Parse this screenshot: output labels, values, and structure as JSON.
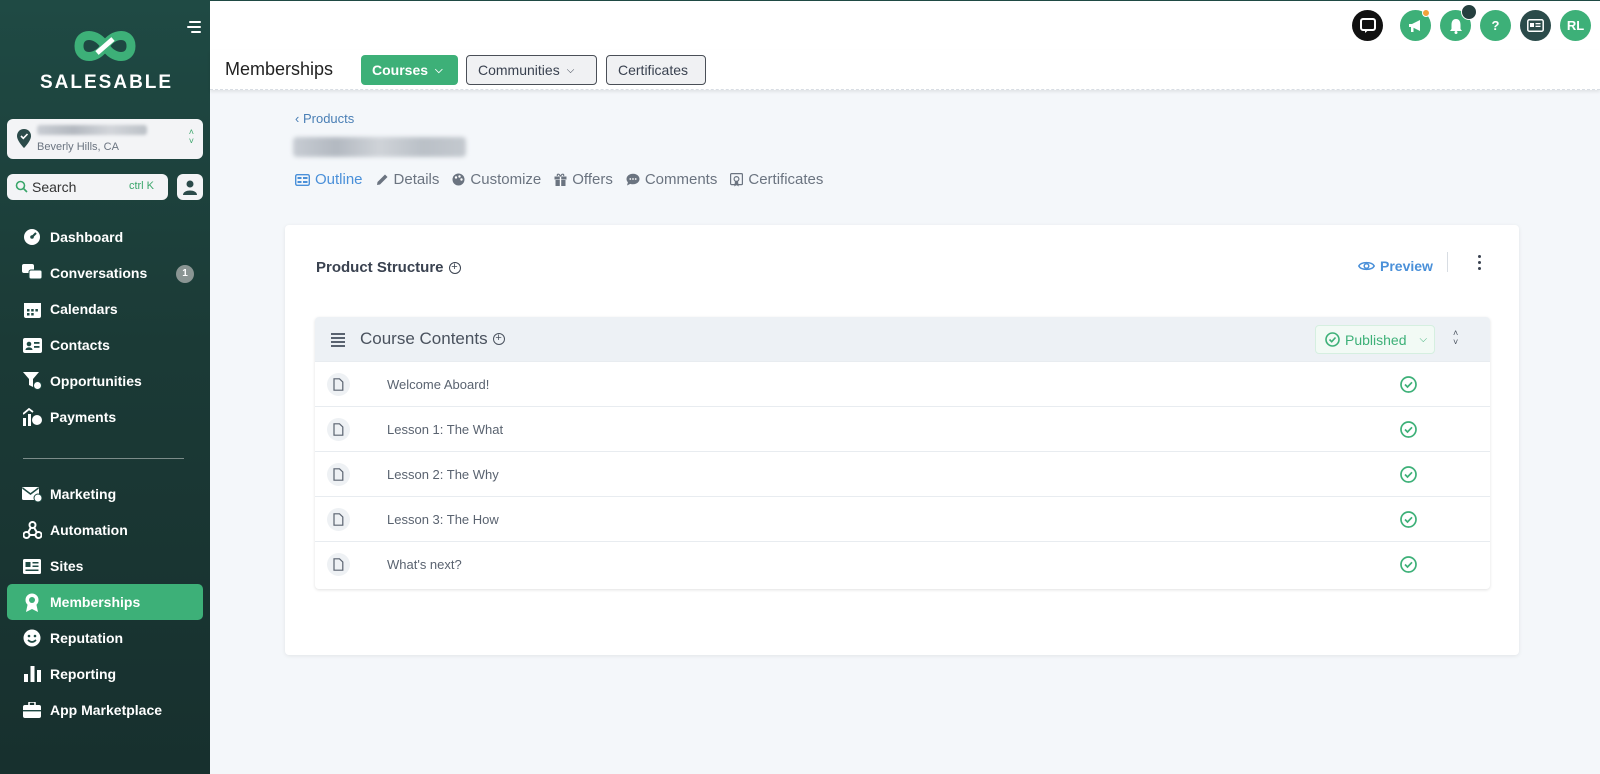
{
  "brand": {
    "name": "SALESABLE"
  },
  "location": {
    "subtitle": "Beverly Hills, CA"
  },
  "search": {
    "label": "Search",
    "shortcut": "ctrl K"
  },
  "nav": {
    "items": [
      {
        "label": "Dashboard",
        "icon": "dashboard-icon"
      },
      {
        "label": "Conversations",
        "icon": "conversations-icon",
        "badge": "1"
      },
      {
        "label": "Calendars",
        "icon": "calendar-icon"
      },
      {
        "label": "Contacts",
        "icon": "contacts-icon"
      },
      {
        "label": "Opportunities",
        "icon": "opportunities-icon"
      },
      {
        "label": "Payments",
        "icon": "payments-icon"
      }
    ],
    "items2": [
      {
        "label": "Marketing",
        "icon": "marketing-icon"
      },
      {
        "label": "Automation",
        "icon": "automation-icon"
      },
      {
        "label": "Sites",
        "icon": "sites-icon"
      },
      {
        "label": "Memberships",
        "icon": "memberships-icon",
        "active": true
      },
      {
        "label": "Reputation",
        "icon": "reputation-icon"
      },
      {
        "label": "Reporting",
        "icon": "reporting-icon"
      },
      {
        "label": "App Marketplace",
        "icon": "app-marketplace-icon"
      }
    ]
  },
  "topbar": {
    "avatar_initials": "RL",
    "help_label": "?"
  },
  "subbar": {
    "title": "Memberships",
    "courses_label": "Courses",
    "communities_label": "Communities",
    "certificates_label": "Certificates"
  },
  "page": {
    "back_label": "Products",
    "tabs": [
      {
        "label": "Outline",
        "active": true
      },
      {
        "label": "Details"
      },
      {
        "label": "Customize"
      },
      {
        "label": "Offers"
      },
      {
        "label": "Comments"
      },
      {
        "label": "Certificates"
      }
    ]
  },
  "structure": {
    "title": "Product Structure",
    "preview_label": "Preview",
    "section_title": "Course Contents",
    "status_label": "Published",
    "lessons": [
      "Welcome Aboard!",
      "Lesson 1: The What",
      "Lesson 2: The Why",
      "Lesson 3: The How",
      "What's next?"
    ]
  },
  "colors": {
    "accent": "#3db078",
    "sidebar": "#1f4a44",
    "link": "#4a90d9"
  }
}
